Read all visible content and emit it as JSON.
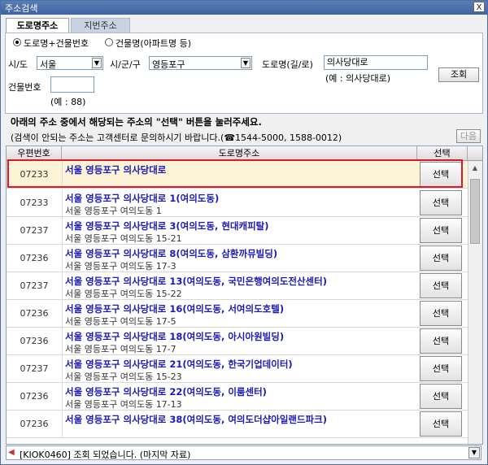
{
  "window": {
    "title": "주소검색",
    "close_label": "X"
  },
  "tabs": [
    {
      "label": "도로명주소"
    },
    {
      "label": "지번주소"
    }
  ],
  "search_type": {
    "option_road": "도로명+건물번호",
    "option_building": "건물명(아파트명 등)"
  },
  "form": {
    "sido_label": "시/도",
    "sido_value": "서울",
    "sigungu_label": "시/군/구",
    "sigungu_value": "영등포구",
    "road_label": "도로명(길/로)",
    "road_value": "의사당대로",
    "road_example": "(예 : 의사당대로)",
    "building_no_label": "건물번호",
    "building_no_value": "",
    "building_no_example": "(예 : 88)",
    "search_button": "조회"
  },
  "instructions": {
    "line1": "아래의 주소 중에서 해당되는 주소의 \"선택\" 버튼을 눌러주세요.",
    "line2": "(검색이 안되는 주소는 고객센터로 문의하시기 바랍니다.(☎1544-5000, 1588-0012)",
    "next_button": "다음"
  },
  "table": {
    "headers": {
      "zip": "우편번호",
      "address": "도로명주소",
      "select": "선택"
    },
    "select_label": "선택",
    "rows": [
      {
        "zip": "07233",
        "road": "서울 영등포구 의사당대로",
        "jibun": ""
      },
      {
        "zip": "07233",
        "road": "서울 영등포구 의사당대로 1(여의도동)",
        "jibun": "서울 영등포구 여의도동  1"
      },
      {
        "zip": "07237",
        "road": "서울 영등포구 의사당대로 3(여의도동, 현대캐피탈)",
        "jibun": "서울 영등포구 여의도동  15-21"
      },
      {
        "zip": "07236",
        "road": "서울 영등포구 의사당대로 8(여의도동, 삼환까뮤빌딩)",
        "jibun": "서울 영등포구 여의도동  17-3"
      },
      {
        "zip": "07237",
        "road": "서울 영등포구 의사당대로 13(여의도동, 국민은행여의도전산센터)",
        "jibun": "서울 영등포구 여의도동  15-22"
      },
      {
        "zip": "07236",
        "road": "서울 영등포구 의사당대로 16(여의도동, 서여의도호텔)",
        "jibun": "서울 영등포구 여의도동  17-5"
      },
      {
        "zip": "07236",
        "road": "서울 영등포구 의사당대로 18(여의도동, 아시아원빌딩)",
        "jibun": "서울 영등포구 여의도동  17-7"
      },
      {
        "zip": "07237",
        "road": "서울 영등포구 의사당대로 21(여의도동, 한국기업데이터)",
        "jibun": "서울 영등포구 여의도동  15-23"
      },
      {
        "zip": "07236",
        "road": "서울 영등포구 의사당대로 22(여의도동, 이룸센터)",
        "jibun": "서울 영등포구 여의도동  17-13"
      },
      {
        "zip": "07236",
        "road": "서울 영등포구 의사당대로 38(여의도동, 여의도더샵아일랜드파크)",
        "jibun": ""
      }
    ]
  },
  "status": {
    "message": "[KIOK0460] 조회 되었습니다. (마지막 자료)"
  },
  "colors": {
    "selected_row_border": "#e0142b",
    "address_text": "#1a1ab8",
    "title_bar": "#4a6ea9"
  },
  "icons": {
    "close": "close-icon",
    "dropdown": "chevron-down-icon",
    "status": "speaker-icon"
  }
}
